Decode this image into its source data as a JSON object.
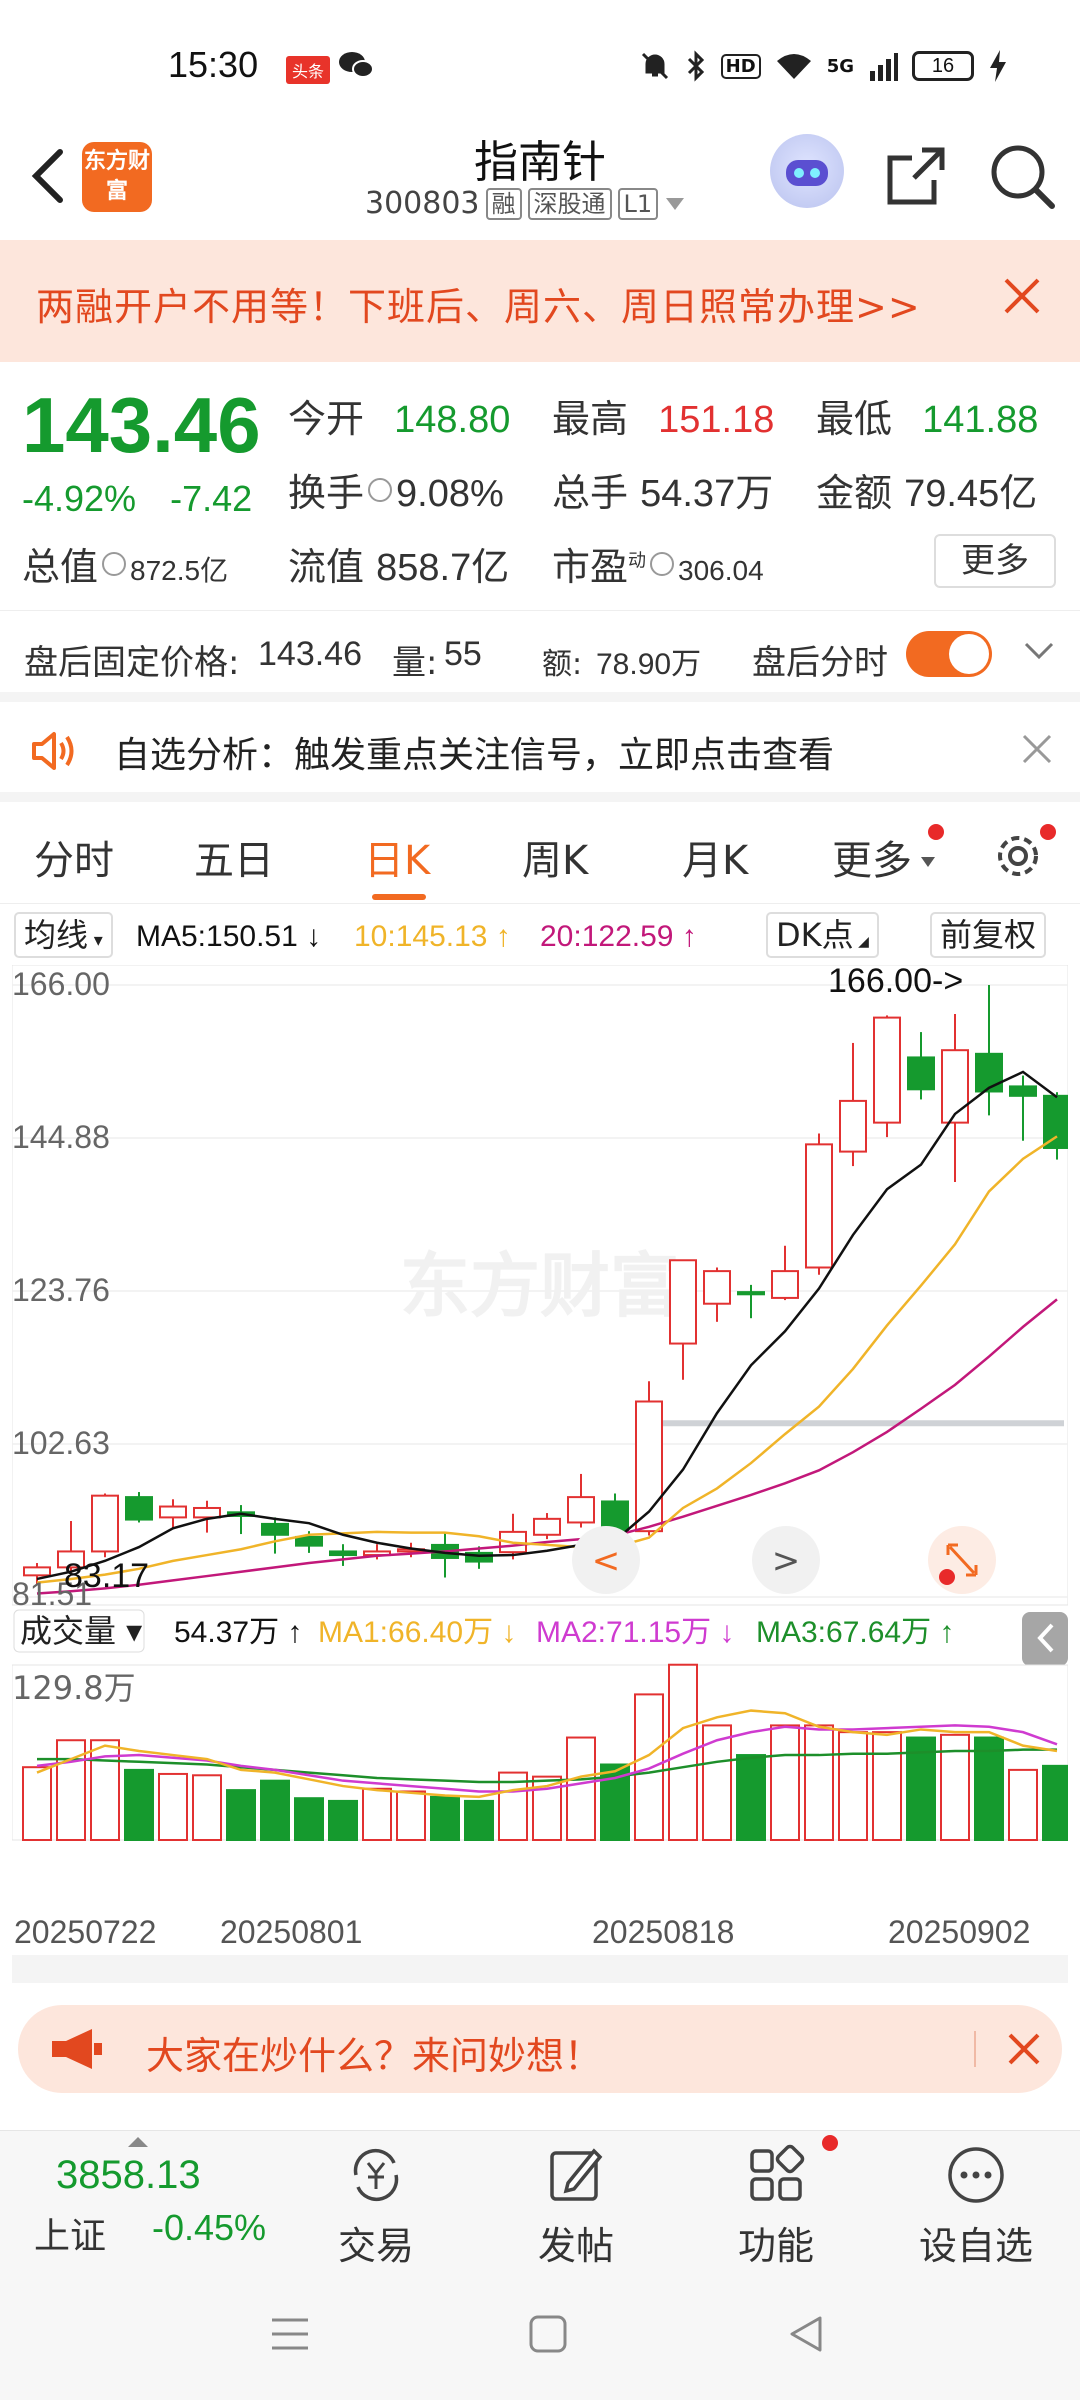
{
  "status_bar": {
    "time": "15:30",
    "toutiao_badge": "头条",
    "battery": "16",
    "signal_label": "5G",
    "hd_label": "HD"
  },
  "header": {
    "logo_text": "东方财富",
    "title": "指南针",
    "code": "300803",
    "tags": [
      "融",
      "深股通",
      "L1"
    ]
  },
  "banner": {
    "text": "两融开户不用等！下班后、周六、周日照常办理>>"
  },
  "quote": {
    "price": "143.46",
    "change_pct": "-4.92%",
    "change_amt": "-7.42",
    "open_label": "今开",
    "open": "148.80",
    "high_label": "最高",
    "high": "151.18",
    "low_label": "最低",
    "low": "141.88",
    "turnover_label": "换手",
    "turnover": "9.08%",
    "volume_label": "总手",
    "volume": "54.37万",
    "amount_label": "金额",
    "amount": "79.45亿",
    "mktcap_label": "总值",
    "mktcap": "872.5亿",
    "float_label": "流值",
    "float": "858.7亿",
    "pe_label": "市盈",
    "pe_sup": "动",
    "pe": "306.04",
    "more": "更多"
  },
  "after_hours": {
    "label": "盘后固定价格:",
    "price": "143.46",
    "vol_label": "量:",
    "vol": "55",
    "amt_label": "额:",
    "amt": "78.90万",
    "toggle_label": "盘后分时"
  },
  "alert": {
    "text": "自选分析：触发重点关注信号，立即点击查看"
  },
  "tabs": [
    "分时",
    "五日",
    "日K",
    "周K",
    "月K",
    "更多"
  ],
  "ma_bar": {
    "select": "均线",
    "ma5": "MA5:150.51 ↓",
    "ma10": "10:145.13 ↑",
    "ma20": "20:122.59 ↑",
    "dk": "DK点",
    "adjust": "前复权"
  },
  "vol_bar": {
    "select": "成交量",
    "vol": "54.37万 ↑",
    "ma1": "MA1:66.40万 ↓",
    "ma2": "MA2:71.15万 ↓",
    "ma3": "MA3:67.64万 ↑"
  },
  "colors": {
    "up": "#e23131",
    "down": "#159a2e",
    "accent": "#f26a21",
    "ma5": "#111111",
    "ma10": "#f0b429",
    "ma20": "#c2187a",
    "vol_ma2": "#cf3bd0",
    "vol_ma3": "#1d8f2a"
  },
  "chart_data": [
    {
      "type": "candlestick",
      "y_ticks": [
        "166.00",
        "144.88",
        "123.76",
        "102.63",
        "81.51"
      ],
      "ylim": [
        81.51,
        166.0
      ],
      "high_marker": "166.00->",
      "low_marker": "83.17",
      "x_labels": [
        "20250722",
        "20250801",
        "20250818",
        "20250902"
      ],
      "candles": [
        {
          "o": 84.5,
          "h": 86.2,
          "l": 83.17,
          "c": 85.6
        },
        {
          "o": 85.6,
          "h": 92.0,
          "l": 84.8,
          "c": 87.8
        },
        {
          "o": 87.8,
          "h": 95.8,
          "l": 87.0,
          "c": 95.5
        },
        {
          "o": 95.3,
          "h": 96.0,
          "l": 91.8,
          "c": 92.2
        },
        {
          "o": 92.5,
          "h": 95.0,
          "l": 91.0,
          "c": 94.0
        },
        {
          "o": 92.5,
          "h": 94.8,
          "l": 90.4,
          "c": 93.8
        },
        {
          "o": 93.2,
          "h": 94.2,
          "l": 90.2,
          "c": 92.7
        },
        {
          "o": 91.6,
          "h": 92.5,
          "l": 87.5,
          "c": 90.1
        },
        {
          "o": 89.8,
          "h": 90.6,
          "l": 87.6,
          "c": 88.6
        },
        {
          "o": 87.8,
          "h": 88.8,
          "l": 85.8,
          "c": 87.3
        },
        {
          "o": 87.3,
          "h": 88.8,
          "l": 86.7,
          "c": 87.8
        },
        {
          "o": 87.8,
          "h": 89.0,
          "l": 87.0,
          "c": 88.1
        },
        {
          "o": 88.7,
          "h": 90.4,
          "l": 84.2,
          "c": 86.9
        },
        {
          "o": 87.6,
          "h": 88.5,
          "l": 85.4,
          "c": 86.4
        },
        {
          "o": 87.7,
          "h": 93.0,
          "l": 86.7,
          "c": 90.5
        },
        {
          "o": 90.1,
          "h": 93.1,
          "l": 89.5,
          "c": 92.3
        },
        {
          "o": 91.8,
          "h": 98.5,
          "l": 91.1,
          "c": 95.3
        },
        {
          "o": 94.7,
          "h": 95.8,
          "l": 90.4,
          "c": 90.6
        },
        {
          "o": 90.6,
          "h": 111.3,
          "l": 90.0,
          "c": 108.5
        },
        {
          "o": 116.5,
          "h": 127.5,
          "l": 111.5,
          "c": 128.0
        },
        {
          "o": 122.0,
          "h": 127.0,
          "l": 119.5,
          "c": 126.5
        },
        {
          "o": 123.6,
          "h": 124.6,
          "l": 120.0,
          "c": 123.3
        },
        {
          "o": 122.8,
          "h": 130.0,
          "l": 122.5,
          "c": 126.5
        },
        {
          "o": 127.0,
          "h": 145.5,
          "l": 126.0,
          "c": 144.0
        },
        {
          "o": 143.0,
          "h": 158.0,
          "l": 141.0,
          "c": 150.0
        },
        {
          "o": 147.0,
          "h": 161.8,
          "l": 145.0,
          "c": 161.5
        },
        {
          "o": 156.0,
          "h": 159.5,
          "l": 150.2,
          "c": 151.6
        },
        {
          "o": 147.0,
          "h": 162.0,
          "l": 138.8,
          "c": 157.0
        },
        {
          "o": 156.5,
          "h": 166.0,
          "l": 148.0,
          "c": 151.3
        },
        {
          "o": 152.0,
          "h": 153.5,
          "l": 144.5,
          "c": 150.7
        },
        {
          "o": 150.7,
          "h": 151.2,
          "l": 141.9,
          "c": 143.5
        }
      ],
      "ma5": [
        84.0,
        85.0,
        86.5,
        88.4,
        91.0,
        92.3,
        93.0,
        92.3,
        91.7,
        90.1,
        89.0,
        88.2,
        87.6,
        87.2,
        87.3,
        87.9,
        88.7,
        89.3,
        93.3,
        99.1,
        106.9,
        113.5,
        118.2,
        124.1,
        131.5,
        137.8,
        141.2,
        148.2,
        151.8,
        154.0,
        150.5
      ],
      "ma10": [
        83.5,
        84.0,
        84.6,
        85.4,
        86.5,
        87.3,
        88.1,
        89.2,
        90.1,
        90.3,
        90.5,
        90.4,
        90.4,
        89.9,
        89.0,
        88.7,
        88.4,
        88.4,
        89.7,
        93.8,
        96.5,
        100.0,
        104.0,
        107.8,
        113.0,
        119.0,
        124.5,
        130.2,
        137.5,
        142.0,
        145.1
      ],
      "ma20": [
        82.0,
        82.3,
        82.7,
        83.2,
        83.8,
        84.4,
        85.0,
        85.6,
        86.2,
        86.7,
        87.2,
        87.5,
        87.8,
        88.2,
        88.6,
        89.1,
        89.5,
        90.0,
        91.2,
        92.6,
        94.1,
        95.6,
        97.2,
        99.0,
        101.5,
        104.3,
        107.5,
        110.8,
        114.7,
        118.8,
        122.6
      ]
    },
    {
      "type": "bar",
      "y_ticks": [
        "129.8万"
      ],
      "ylim": [
        0,
        129.8
      ],
      "volumes": [
        54,
        74,
        74,
        52,
        49,
        48,
        37,
        44,
        31,
        29,
        38,
        36,
        32,
        29,
        50,
        47,
        76,
        56,
        108,
        130,
        85,
        63,
        85,
        85,
        80,
        80,
        76,
        78,
        76,
        52,
        55
      ],
      "up": [
        1,
        1,
        1,
        0,
        1,
        1,
        0,
        0,
        0,
        0,
        1,
        1,
        0,
        0,
        1,
        1,
        1,
        0,
        1,
        1,
        1,
        0,
        1,
        1,
        1,
        1,
        0,
        1,
        0,
        1,
        0
      ],
      "ma1": [
        50,
        60,
        70,
        66,
        63,
        60,
        52,
        50,
        45,
        40,
        37,
        35,
        33,
        32,
        37,
        40,
        47,
        51,
        63,
        83,
        91,
        96,
        94,
        84,
        80,
        78,
        82,
        80,
        80,
        70,
        66
      ],
      "ma2": [
        55,
        58,
        62,
        63,
        61,
        59,
        55,
        52,
        48,
        44,
        42,
        40,
        38,
        36,
        36,
        38,
        42,
        46,
        53,
        64,
        74,
        80,
        84,
        82,
        82,
        83,
        84,
        85,
        84,
        80,
        71
      ],
      "ma3": [
        60,
        60,
        59,
        58,
        57,
        56,
        54,
        52,
        50,
        48,
        46,
        45,
        44,
        43,
        43,
        44,
        45,
        47,
        50,
        54,
        58,
        61,
        63,
        63,
        64,
        64,
        65,
        66,
        66,
        67,
        67
      ]
    }
  ],
  "chart_nav": {
    "prev": "<",
    "next": ">"
  },
  "ask_banner": {
    "text": "大家在炒什么？来问妙想！"
  },
  "bottom_nav": {
    "index_value": "3858.13",
    "index_name": "上证",
    "index_change": "-0.45%",
    "items": [
      "交易",
      "发帖",
      "功能",
      "设自选"
    ]
  }
}
